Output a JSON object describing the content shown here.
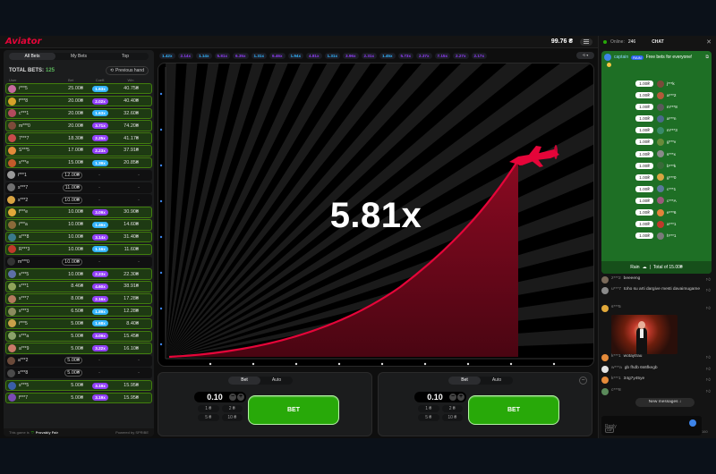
{
  "header": {
    "logo": "Aviator",
    "balance": "99.76 ₴"
  },
  "bets_panel": {
    "tabs": [
      {
        "label": "All Bets",
        "active": true
      },
      {
        "label": "My Bets",
        "active": false
      },
      {
        "label": "Top",
        "active": false
      }
    ],
    "total_label": "TOTAL BETS:",
    "total_count": "125",
    "previous_hand": "Previous hand",
    "columns": [
      "User",
      "Bet",
      "Coeff.",
      "Win"
    ],
    "rows": [
      {
        "user": "i***5",
        "bet": "25.00₴",
        "mult": "1.63x",
        "win": "40.75₴",
        "won": true,
        "mult_color": "#34b4ff",
        "avatar": "#c66a9e"
      },
      {
        "user": "f***8",
        "bet": "20.00₴",
        "mult": "2.02x",
        "win": "40.40₴",
        "won": true,
        "mult_color": "#913ef8",
        "avatar": "#d7a22a"
      },
      {
        "user": "c***1",
        "bet": "20.00₴",
        "mult": "1.63x",
        "win": "32.60₴",
        "won": true,
        "mult_color": "#34b4ff",
        "avatar": "#b34a5e"
      },
      {
        "user": "m***0",
        "bet": "20.00₴",
        "mult": "3.71x",
        "win": "74.20₴",
        "won": true,
        "mult_color": "#913ef8",
        "avatar": "#7d4b3a"
      },
      {
        "user": "7***7",
        "bet": "18.30₴",
        "mult": "2.25x",
        "win": "41.17₴",
        "won": true,
        "mult_color": "#913ef8",
        "avatar": "#c74b4b"
      },
      {
        "user": "S***5",
        "bet": "17.00₴",
        "mult": "2.23x",
        "win": "37.91₴",
        "won": true,
        "mult_color": "#913ef8",
        "avatar": "#e58b3a"
      },
      {
        "user": "s***e",
        "bet": "15.00₴",
        "mult": "1.39x",
        "win": "20.85₴",
        "won": true,
        "mult_color": "#34b4ff",
        "avatar": "#c45a2b"
      },
      {
        "user": "i***1",
        "bet": "12.00₴",
        "mult": "",
        "win": "",
        "won": false,
        "mult_color": "",
        "avatar": "#9a9a9a"
      },
      {
        "user": "s***7",
        "bet": "11.00₴",
        "mult": "",
        "win": "",
        "won": false,
        "mult_color": "",
        "avatar": "#6f6f6f"
      },
      {
        "user": "s***2",
        "bet": "10.00₴",
        "mult": "",
        "win": "",
        "won": false,
        "mult_color": "",
        "avatar": "#d9a442"
      },
      {
        "user": "f***e",
        "bet": "10.00₴",
        "mult": "3.09x",
        "win": "30.90₴",
        "won": true,
        "mult_color": "#913ef8",
        "avatar": "#e2a93a"
      },
      {
        "user": "i***a",
        "bet": "10.00₴",
        "mult": "1.46x",
        "win": "14.60₴",
        "won": true,
        "mult_color": "#34b4ff",
        "avatar": "#8b6a3a"
      },
      {
        "user": "a***8",
        "bet": "10.00₴",
        "mult": "3.14x",
        "win": "31.40₴",
        "won": true,
        "mult_color": "#913ef8",
        "avatar": "#3a7a8b"
      },
      {
        "user": "R***3",
        "bet": "10.00₴",
        "mult": "1.16x",
        "win": "11.60₴",
        "won": true,
        "mult_color": "#34b4ff",
        "avatar": "#c0392b"
      },
      {
        "user": "m***0",
        "bet": "10.00₴",
        "mult": "",
        "win": "",
        "won": false,
        "mult_color": "",
        "avatar": "#333333"
      },
      {
        "user": "s***5",
        "bet": "10.00₴",
        "mult": "2.23x",
        "win": "22.30₴",
        "won": true,
        "mult_color": "#913ef8",
        "avatar": "#5e6fa8"
      },
      {
        "user": "s***1",
        "bet": "8.46₴",
        "mult": "4.60x",
        "win": "38.91₴",
        "won": true,
        "mult_color": "#913ef8",
        "avatar": "#8fa35b"
      },
      {
        "user": "s***7",
        "bet": "8.00₴",
        "mult": "2.16x",
        "win": "17.28₴",
        "won": true,
        "mult_color": "#913ef8",
        "avatar": "#b37a5e"
      },
      {
        "user": "s***3",
        "bet": "6.50₴",
        "mult": "1.89x",
        "win": "12.28₴",
        "won": true,
        "mult_color": "#34b4ff",
        "avatar": "#8b8b5e"
      },
      {
        "user": "i***5",
        "bet": "5.00₴",
        "mult": "1.68x",
        "win": "8.40₴",
        "won": true,
        "mult_color": "#34b4ff",
        "avatar": "#c9a04a"
      },
      {
        "user": "s***a",
        "bet": "5.00₴",
        "mult": "3.09x",
        "win": "15.45₴",
        "won": true,
        "mult_color": "#913ef8",
        "avatar": "#8aa26a"
      },
      {
        "user": "a***9",
        "bet": "5.00₴",
        "mult": "3.22x",
        "win": "16.10₴",
        "won": true,
        "mult_color": "#913ef8",
        "avatar": "#c97a6a"
      },
      {
        "user": "a***2",
        "bet": "5.00₴",
        "mult": "",
        "win": "",
        "won": false,
        "mult_color": "",
        "avatar": "#6a4a3a"
      },
      {
        "user": "s***8",
        "bet": "5.00₴",
        "mult": "",
        "win": "",
        "won": false,
        "mult_color": "",
        "avatar": "#4a4a4a"
      },
      {
        "user": "s***5",
        "bet": "5.00₴",
        "mult": "3.19x",
        "win": "15.95₴",
        "won": true,
        "mult_color": "#913ef8",
        "avatar": "#3a5ea8"
      },
      {
        "user": "f***7",
        "bet": "5.00₴",
        "mult": "3.19x",
        "win": "15.95₴",
        "won": true,
        "mult_color": "#913ef8",
        "avatar": "#7a4ab3"
      }
    ],
    "footer_left": "This game is",
    "footer_fair": "Provably Fair",
    "footer_powered": "Powered by SPRIBE"
  },
  "history": [
    {
      "value": "1.42x",
      "color": "#34b4ff"
    },
    {
      "value": "2.14x",
      "color": "#913ef8"
    },
    {
      "value": "1.14x",
      "color": "#34b4ff"
    },
    {
      "value": "5.81x",
      "color": "#913ef8"
    },
    {
      "value": "6.35x",
      "color": "#913ef8"
    },
    {
      "value": "1.31x",
      "color": "#34b4ff"
    },
    {
      "value": "6.46x",
      "color": "#913ef8"
    },
    {
      "value": "1.94x",
      "color": "#34b4ff"
    },
    {
      "value": "4.81x",
      "color": "#913ef8"
    },
    {
      "value": "1.31x",
      "color": "#34b4ff"
    },
    {
      "value": "3.96x",
      "color": "#913ef8"
    },
    {
      "value": "2.31x",
      "color": "#913ef8"
    },
    {
      "value": "1.45x",
      "color": "#34b4ff"
    },
    {
      "value": "5.73x",
      "color": "#913ef8"
    },
    {
      "value": "2.37x",
      "color": "#913ef8"
    },
    {
      "value": "7.15x",
      "color": "#913ef8"
    },
    {
      "value": "2.27x",
      "color": "#913ef8"
    },
    {
      "value": "2.17x",
      "color": "#913ef8"
    }
  ],
  "game": {
    "multiplier": "5.81x",
    "plane_color": "#e50539"
  },
  "bet_panels": [
    {
      "tabs": [
        "Bet",
        "Auto"
      ],
      "stake": "0.10",
      "quick": [
        "1 ₴",
        "2 ₴",
        "5 ₴",
        "10 ₴"
      ],
      "button": "BET"
    },
    {
      "tabs": [
        "Bet",
        "Auto"
      ],
      "stake": "0.10",
      "quick": [
        "1 ₴",
        "2 ₴",
        "5 ₴",
        "10 ₴"
      ],
      "button": "BET"
    }
  ],
  "chat": {
    "online_label": "Online:",
    "online_count": "246",
    "title": "CHAT",
    "rain": {
      "user": "captain",
      "tag": "RAIN",
      "message": "Free bets for everyone!",
      "entries": [
        {
          "amount": "1.00₴",
          "name": "j***k",
          "avatar": "#7a4a3a"
        },
        {
          "amount": "1.00₴",
          "name": "a***2",
          "avatar": "#b35a3a"
        },
        {
          "amount": "1.00₴",
          "name": "m***8",
          "avatar": "#5a5a5a"
        },
        {
          "amount": "1.00₴",
          "name": "a***n",
          "avatar": "#4a6a8a"
        },
        {
          "amount": "1.00₴",
          "name": "m***3",
          "avatar": "#3a8a6a"
        },
        {
          "amount": "1.00₴",
          "name": "g***v",
          "avatar": "#6a8a3a"
        },
        {
          "amount": "1.00₴",
          "name": "s***x",
          "avatar": "#8a8a8a"
        },
        {
          "amount": "1.00₴",
          "name": "b***k",
          "avatar": "#3a6a3a"
        },
        {
          "amount": "1.00₴",
          "name": "g***0",
          "avatar": "#d9a442"
        },
        {
          "amount": "1.00₴",
          "name": "c***1",
          "avatar": "#5a7a9a"
        },
        {
          "amount": "1.00₴",
          "name": "c***A",
          "avatar": "#9a5a7a"
        },
        {
          "amount": "1.00₴",
          "name": "e***6",
          "avatar": "#e2833a"
        },
        {
          "amount": "1.00₴",
          "name": "a***1",
          "avatar": "#c0392b"
        },
        {
          "amount": "1.00₴",
          "name": "h***1",
          "avatar": "#7a7a7a"
        }
      ],
      "footer": "Rain",
      "total": "Total of 15.00₴"
    },
    "messages": [
      {
        "user": "z***2",
        "text": "beeeeng",
        "avatar": "#7a6a5a"
      },
      {
        "user": "u***7",
        "text": "toho su arti dargive mesti davaimugame",
        "avatar": "#8a8a8a"
      },
      {
        "user": "s***5",
        "text": "",
        "avatar": "#e2a93a"
      },
      {
        "user": "k***1",
        "text": "wotaytrau",
        "avatar": "#e58b3a"
      },
      {
        "user": "w***a",
        "text": "gb fhdb 6s6fkegb",
        "avatar": "#e5e5e5"
      },
      {
        "user": "k***1",
        "text": "34g7y45ye",
        "avatar": "#e58b3a"
      },
      {
        "user": "c***8",
        "text": "",
        "avatar": "#5a8a5a"
      }
    ],
    "new_messages": "New messages ↓",
    "reply_placeholder": "Reply",
    "gif": "GIF",
    "char_count": "160"
  }
}
